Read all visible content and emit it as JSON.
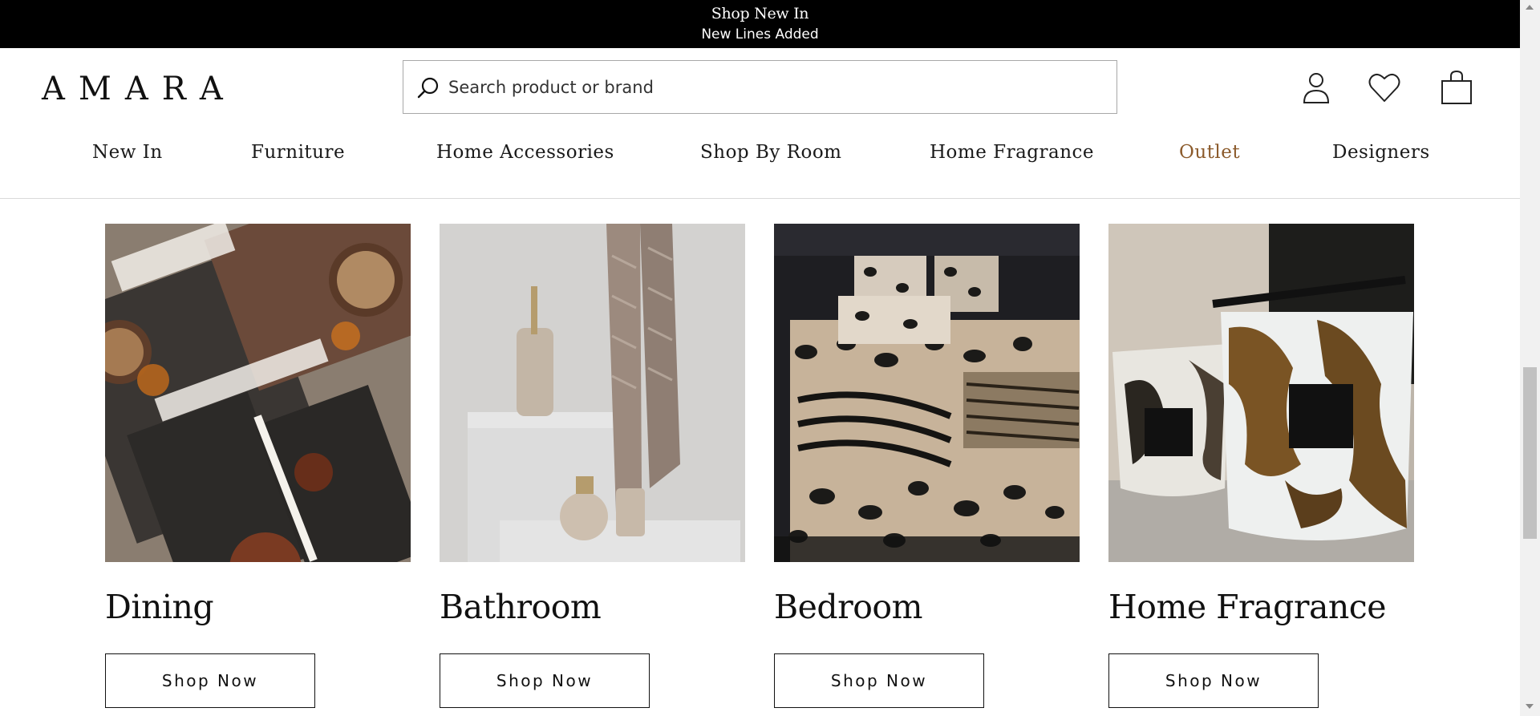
{
  "promo": {
    "line1": "Shop New In",
    "line2": "New Lines Added"
  },
  "header": {
    "logo": "AMARA",
    "search": {
      "placeholder": "Search product or brand",
      "value": ""
    },
    "icons": [
      "search-icon",
      "account-icon",
      "wishlist-heart-icon",
      "shopping-bag-icon"
    ]
  },
  "nav": {
    "items": [
      {
        "label": "New In"
      },
      {
        "label": "Furniture"
      },
      {
        "label": "Home Accessories"
      },
      {
        "label": "Shop By Room"
      },
      {
        "label": "Home Fragrance"
      },
      {
        "label": "Outlet",
        "accent": "#8b5a2b"
      },
      {
        "label": "Designers"
      }
    ]
  },
  "categories": [
    {
      "title": "Dining",
      "button": "Shop Now",
      "image": "dining-table-setting-image"
    },
    {
      "title": "Bathroom",
      "button": "Shop Now",
      "image": "bathroom-accessories-image"
    },
    {
      "title": "Bedroom",
      "button": "Shop Now",
      "image": "leopard-print-bedding-image"
    },
    {
      "title": "Home Fragrance",
      "button": "Shop Now",
      "image": "baobab-candles-image"
    }
  ],
  "colors": {
    "promo_bg": "#000000",
    "accent_outlet": "#8b5a2b",
    "text": "#111111"
  }
}
